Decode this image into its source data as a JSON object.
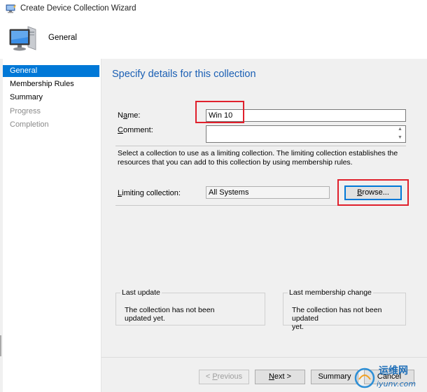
{
  "window": {
    "title": "Create Device Collection Wizard"
  },
  "header": {
    "title": "General"
  },
  "nav": {
    "items": [
      {
        "label": "General",
        "state": "active"
      },
      {
        "label": "Membership Rules",
        "state": "normal"
      },
      {
        "label": "Summary",
        "state": "normal"
      },
      {
        "label": "Progress",
        "state": "disabled"
      },
      {
        "label": "Completion",
        "state": "disabled"
      }
    ]
  },
  "main": {
    "title": "Specify details for this collection",
    "name_label_prefix": "N",
    "name_label_underlined": "a",
    "name_label_suffix": "me:",
    "name_value": "Win 10",
    "comment_label_underlined": "C",
    "comment_label_suffix": "omment:",
    "comment_value": "",
    "limiting_description": "Select a collection to use as a limiting collection. The limiting collection establishes the resources that you can add to this collection by using membership rules.",
    "limiting_label_underlined": "L",
    "limiting_label_suffix": "imiting collection:",
    "limiting_value": "All Systems",
    "browse_underlined": "B",
    "browse_suffix": "rowse...",
    "last_update": {
      "title": "Last update",
      "text_line1": "The collection has not been",
      "text_line2": "updated yet."
    },
    "last_membership_change": {
      "title": "Last membership change",
      "text_line1": "The collection has not been updated",
      "text_line2": "yet."
    }
  },
  "footer": {
    "previous_prefix": "< ",
    "previous_underlined": "P",
    "previous_suffix": "revious",
    "next_underlined": "N",
    "next_suffix": "ext >",
    "summary_label": "Summary",
    "cancel_label": "Cancel"
  },
  "watermark": {
    "line1": "运维网",
    "line2": "iyunv.com"
  },
  "colors": {
    "accent": "#0078d7",
    "title_blue": "#1a5fb4",
    "highlight_red": "#e0202c"
  }
}
